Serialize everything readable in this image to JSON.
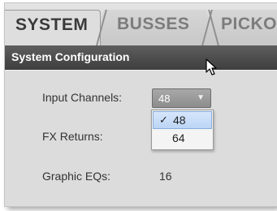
{
  "tabs": [
    {
      "label": "SYSTEM",
      "active": true
    },
    {
      "label": "BUSSES",
      "active": false
    },
    {
      "label": "PICKOF",
      "active": false
    }
  ],
  "panel": {
    "title": "System Configuration"
  },
  "settings": {
    "input_channels": {
      "label": "Input Channels:",
      "value": "48",
      "arrow": "▼"
    },
    "fx_returns": {
      "label": "FX Returns:"
    },
    "graphic_eqs": {
      "label": "Graphic EQs:",
      "value": "16"
    }
  },
  "dropdown": {
    "options": [
      {
        "check": "✓",
        "label": "48",
        "selected": true
      },
      {
        "check": "",
        "label": "64",
        "selected": false
      }
    ]
  },
  "colors": {
    "header_bg": "#4a4a4a",
    "highlight": "#c7dcf7",
    "select_bg": "#9a9a9a"
  }
}
